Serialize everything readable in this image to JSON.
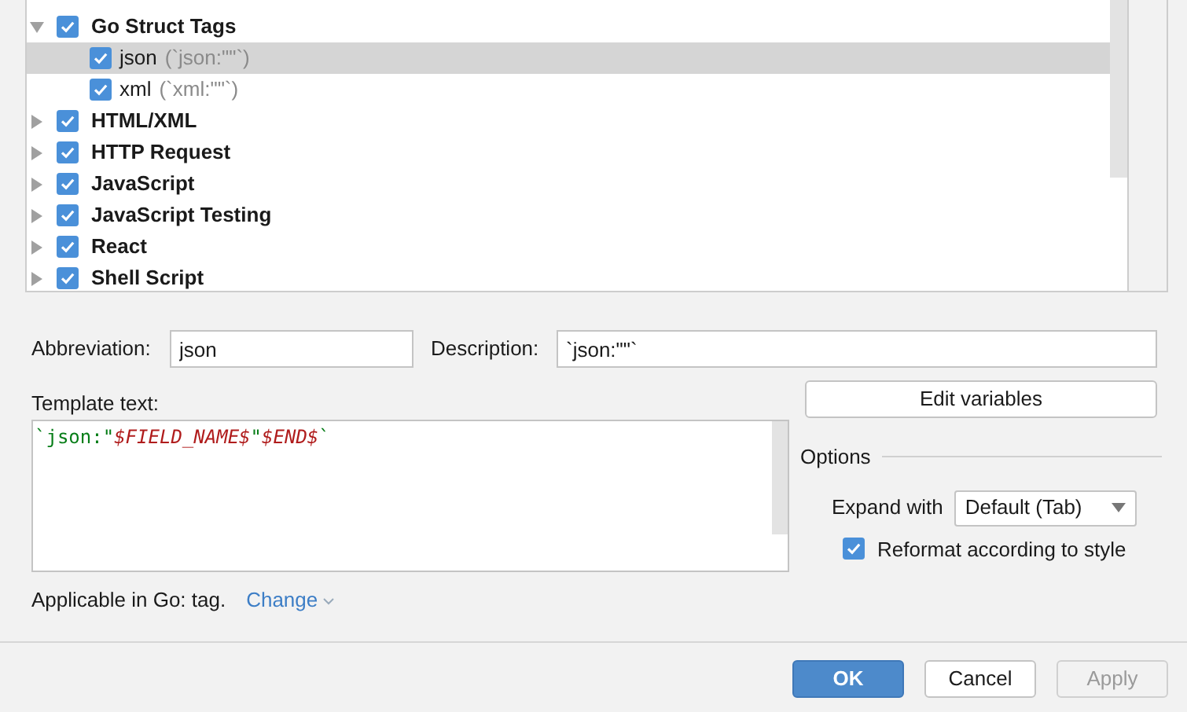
{
  "tree": {
    "groups": [
      {
        "label": "Go Struct Tags",
        "checked": true,
        "expanded": true,
        "selected": false,
        "children": [
          {
            "label": "json",
            "detail": "(`json:\"\"`)",
            "checked": true,
            "selected": true
          },
          {
            "label": "xml",
            "detail": "(`xml:\"\"`)",
            "checked": true,
            "selected": false
          }
        ]
      },
      {
        "label": "HTML/XML",
        "checked": true,
        "expanded": false,
        "selected": false
      },
      {
        "label": "HTTP Request",
        "checked": true,
        "expanded": false,
        "selected": false
      },
      {
        "label": "JavaScript",
        "checked": true,
        "expanded": false,
        "selected": false
      },
      {
        "label": "JavaScript Testing",
        "checked": true,
        "expanded": false,
        "selected": false
      },
      {
        "label": "React",
        "checked": true,
        "expanded": false,
        "selected": false
      },
      {
        "label": "Shell Script",
        "checked": true,
        "expanded": false,
        "selected": false
      }
    ]
  },
  "abbreviation": {
    "label": "Abbreviation:",
    "value": "json"
  },
  "description": {
    "label": "Description:",
    "value": "`json:\"\"`"
  },
  "template": {
    "label": "Template text:",
    "segments": [
      {
        "text": "`json:\"",
        "kind": "string"
      },
      {
        "text": "$FIELD_NAME$",
        "kind": "variable"
      },
      {
        "text": "\"",
        "kind": "string"
      },
      {
        "text": "$END$",
        "kind": "variable"
      },
      {
        "text": "`",
        "kind": "string"
      }
    ]
  },
  "edit_variables": "Edit variables",
  "options": {
    "title": "Options",
    "expand_label": "Expand with",
    "expand_value": "Default (Tab)",
    "reformat": {
      "label": "Reformat according to style",
      "checked": true
    }
  },
  "applicable": {
    "text": "Applicable in Go: tag.",
    "link": "Change"
  },
  "buttons": [
    {
      "label": "OK",
      "kind": "primary",
      "disabled": false
    },
    {
      "label": "Cancel",
      "kind": "normal",
      "disabled": false
    },
    {
      "label": "Apply",
      "kind": "normal",
      "disabled": true
    }
  ]
}
